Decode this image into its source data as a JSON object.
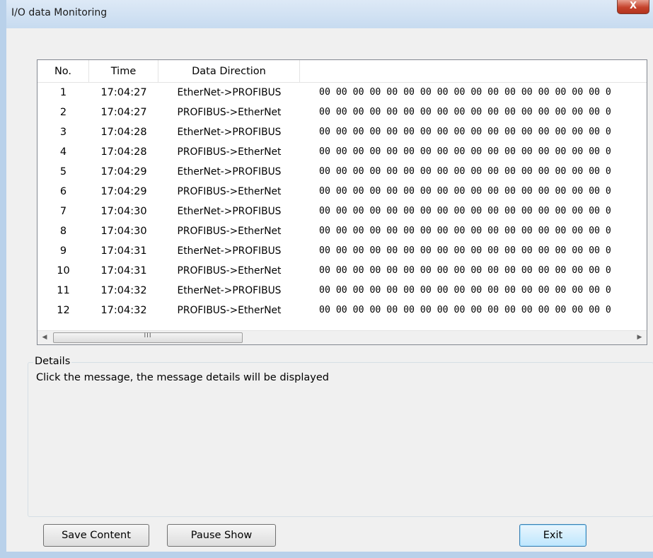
{
  "window": {
    "title": "I/O data Monitoring",
    "close_label": "X"
  },
  "table": {
    "columns": [
      "No.",
      "Time",
      "Data Direction",
      ""
    ],
    "rows": [
      {
        "no": "1",
        "time": "17:04:27",
        "direction": "EtherNet->PROFIBUS",
        "data": "00 00 00 00 00 00 00 00 00 00 00 00 00 00 00 00 00 0"
      },
      {
        "no": "2",
        "time": "17:04:27",
        "direction": "PROFIBUS->EtherNet",
        "data": "00 00 00 00 00 00 00 00 00 00 00 00 00 00 00 00 00 0"
      },
      {
        "no": "3",
        "time": "17:04:28",
        "direction": "EtherNet->PROFIBUS",
        "data": "00 00 00 00 00 00 00 00 00 00 00 00 00 00 00 00 00 0"
      },
      {
        "no": "4",
        "time": "17:04:28",
        "direction": "PROFIBUS->EtherNet",
        "data": "00 00 00 00 00 00 00 00 00 00 00 00 00 00 00 00 00 0"
      },
      {
        "no": "5",
        "time": "17:04:29",
        "direction": "EtherNet->PROFIBUS",
        "data": "00 00 00 00 00 00 00 00 00 00 00 00 00 00 00 00 00 0"
      },
      {
        "no": "6",
        "time": "17:04:29",
        "direction": "PROFIBUS->EtherNet",
        "data": "00 00 00 00 00 00 00 00 00 00 00 00 00 00 00 00 00 0"
      },
      {
        "no": "7",
        "time": "17:04:30",
        "direction": "EtherNet->PROFIBUS",
        "data": "00 00 00 00 00 00 00 00 00 00 00 00 00 00 00 00 00 0"
      },
      {
        "no": "8",
        "time": "17:04:30",
        "direction": "PROFIBUS->EtherNet",
        "data": "00 00 00 00 00 00 00 00 00 00 00 00 00 00 00 00 00 0"
      },
      {
        "no": "9",
        "time": "17:04:31",
        "direction": "EtherNet->PROFIBUS",
        "data": "00 00 00 00 00 00 00 00 00 00 00 00 00 00 00 00 00 0"
      },
      {
        "no": "10",
        "time": "17:04:31",
        "direction": "PROFIBUS->EtherNet",
        "data": "00 00 00 00 00 00 00 00 00 00 00 00 00 00 00 00 00 0"
      },
      {
        "no": "11",
        "time": "17:04:32",
        "direction": "EtherNet->PROFIBUS",
        "data": "00 00 00 00 00 00 00 00 00 00 00 00 00 00 00 00 00 0"
      },
      {
        "no": "12",
        "time": "17:04:32",
        "direction": "PROFIBUS->EtherNet",
        "data": "00 00 00 00 00 00 00 00 00 00 00 00 00 00 00 00 00 0"
      }
    ]
  },
  "scrollbar": {
    "left_arrow": "◀",
    "right_arrow": "▶",
    "grip": "III"
  },
  "details": {
    "legend": "Details",
    "text": "Click the message, the message details will be displayed"
  },
  "buttons": {
    "save": "Save Content",
    "pause": "Pause Show",
    "exit": "Exit"
  }
}
